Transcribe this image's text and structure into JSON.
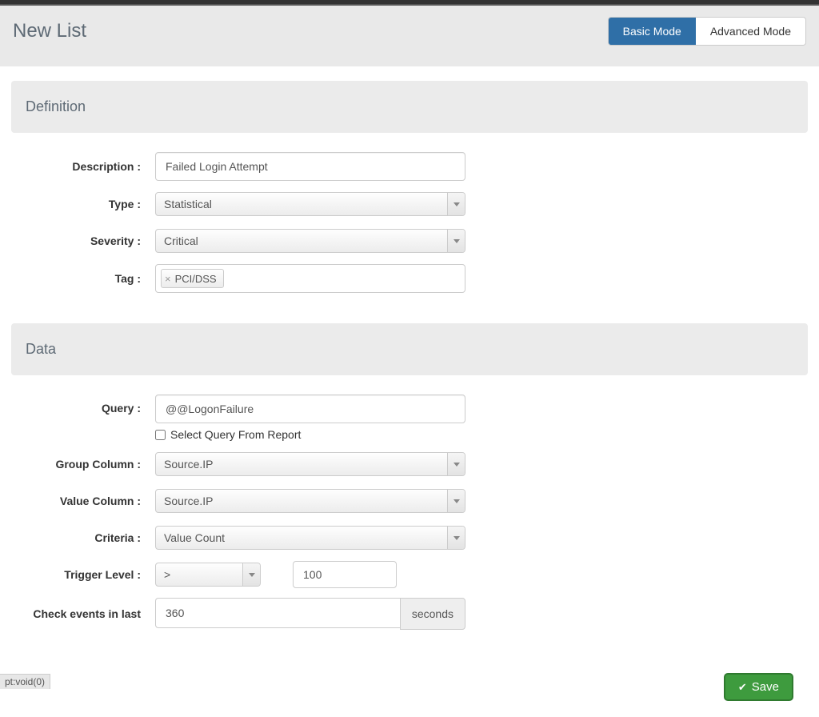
{
  "header": {
    "title": "New List",
    "basic_mode": "Basic Mode",
    "advanced_mode": "Advanced Mode"
  },
  "definition": {
    "heading": "Definition",
    "labels": {
      "description": "Description :",
      "type": "Type :",
      "severity": "Severity :",
      "tag": "Tag :"
    },
    "description_value": "Failed Login Attempt",
    "type_value": "Statistical",
    "severity_value": "Critical",
    "tags": [
      "PCI/DSS"
    ]
  },
  "data": {
    "heading": "Data",
    "labels": {
      "query": "Query :",
      "select_from_report": "Select Query From Report",
      "group_column": "Group Column :",
      "value_column": "Value Column :",
      "criteria": "Criteria :",
      "trigger_level": "Trigger Level :",
      "check_events": "Check events in last"
    },
    "query_value": "@@LogonFailure",
    "group_column_value": "Source.IP",
    "value_column_value": "Source.IP",
    "criteria_value": "Value Count",
    "trigger_op": ">",
    "trigger_val": "100",
    "check_events_value": "360",
    "check_events_unit": "seconds"
  },
  "footer": {
    "save": "Save"
  },
  "status": {
    "corner": "pt:void(0)"
  }
}
